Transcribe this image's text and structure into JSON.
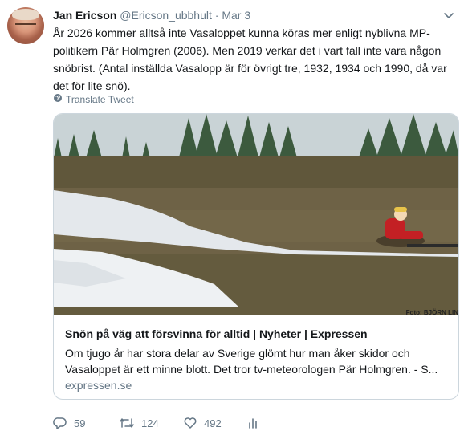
{
  "author": {
    "display_name": "Jan Ericson",
    "screen_name": "@Ericson_ubbhult",
    "separator": "·",
    "time": "Mar 3"
  },
  "tweet": {
    "text": "År 2026 kommer alltså inte Vasaloppet kunna köras mer enligt nyblivna MP-politikern Pär Holmgren (2006). Men 2019 verkar det i vart fall inte vara någon snöbrist. (Antal inställda Vasalopp är för övrigt tre, 1932, 1934 och 1990, då var det för lite snö).",
    "translate_label": "Translate Tweet"
  },
  "card": {
    "title": "Snön på väg att försvinna för alltid | Nyheter | Expressen",
    "description": "Om tjugo år har stora delar av Sverige glömt hur man åker skidor och Vasaloppet är ett minne blott. Det tror tv-meteorologen Pär Holmgren. - S...",
    "domain": "expressen.se",
    "photo_credit": "Foto: BJÖRN LIN"
  },
  "actions": {
    "replies": "59",
    "retweets": "124",
    "likes": "492"
  },
  "colors": {
    "text": "#14171a",
    "secondary": "#657786",
    "border": "#ccd6dd"
  },
  "icons": [
    "chevron-down-icon",
    "globe-icon",
    "reply-icon",
    "retweet-icon",
    "heart-icon",
    "analytics-icon"
  ]
}
